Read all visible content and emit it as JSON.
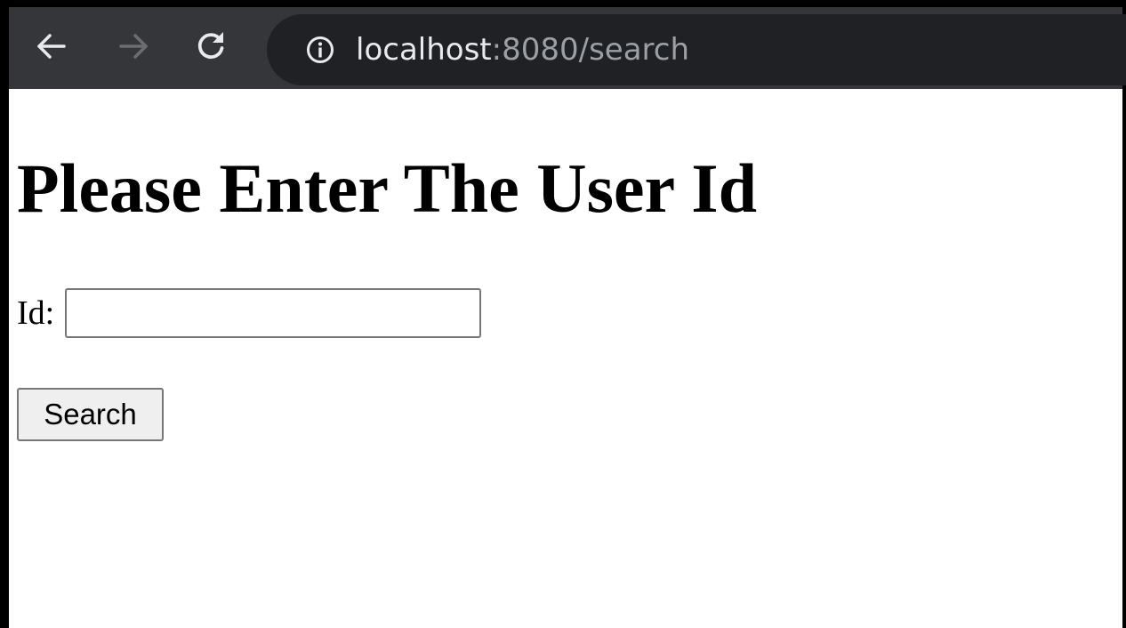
{
  "browser": {
    "back_icon": "arrow-left-icon",
    "forward_icon": "arrow-right-icon",
    "reload_icon": "reload-icon",
    "info_icon": "info-circle-icon",
    "url_host": "localhost",
    "url_rest": ":8080/search",
    "toolbar_color": "#35363a",
    "omnibox_color": "#202124"
  },
  "page": {
    "heading": "Please Enter The User Id",
    "id_label": "Id:",
    "id_value": "",
    "search_label": "Search"
  }
}
